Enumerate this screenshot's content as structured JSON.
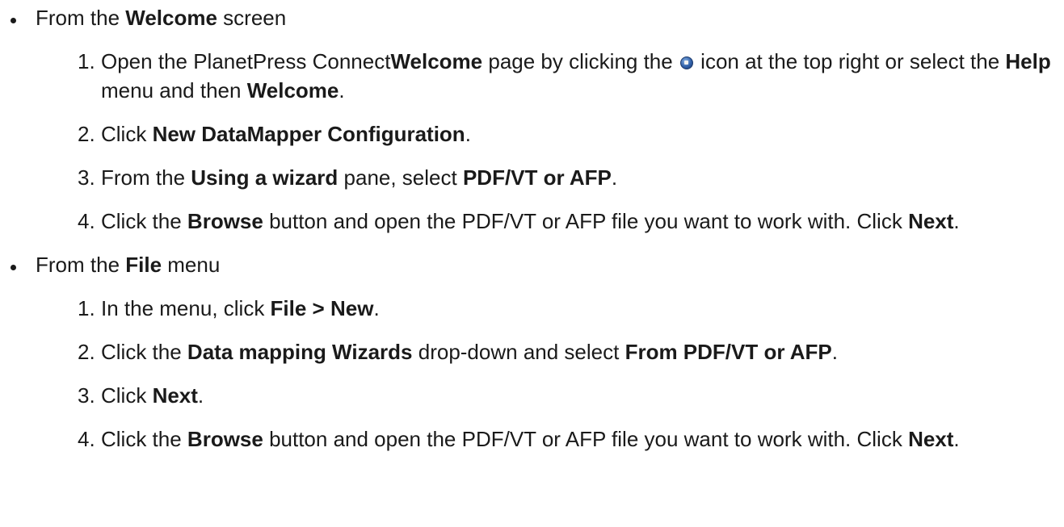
{
  "sections": [
    {
      "head_prefix": "From the ",
      "head_bold": "Welcome",
      "head_suffix": " screen",
      "steps": [
        {
          "num": "1.",
          "parts": [
            {
              "t": "Open the PlanetPress Connect",
              "b": false
            },
            {
              "t": "Welcome",
              "b": true
            },
            {
              "t": " page by clicking the ",
              "b": false
            },
            {
              "icon": "home-globe-icon"
            },
            {
              "t": " icon at the top right or select the ",
              "b": false
            },
            {
              "t": "Help",
              "b": true
            },
            {
              "t": " menu and then ",
              "b": false
            },
            {
              "t": "Welcome",
              "b": true
            },
            {
              "t": ".",
              "b": false
            }
          ]
        },
        {
          "num": "2.",
          "parts": [
            {
              "t": "Click ",
              "b": false
            },
            {
              "t": "New DataMapper Configuration",
              "b": true
            },
            {
              "t": ".",
              "b": false
            }
          ]
        },
        {
          "num": "3.",
          "parts": [
            {
              "t": "From the ",
              "b": false
            },
            {
              "t": "Using a wizard",
              "b": true
            },
            {
              "t": " pane, select ",
              "b": false
            },
            {
              "t": "PDF/VT or AFP",
              "b": true
            },
            {
              "t": ".",
              "b": false
            }
          ]
        },
        {
          "num": "4.",
          "parts": [
            {
              "t": "Click the ",
              "b": false
            },
            {
              "t": "Browse",
              "b": true
            },
            {
              "t": " button and open the PDF/VT or AFP file you want to work with. Click ",
              "b": false
            },
            {
              "t": "Next",
              "b": true
            },
            {
              "t": ".",
              "b": false
            }
          ]
        }
      ]
    },
    {
      "head_prefix": "From the ",
      "head_bold": "File",
      "head_suffix": " menu",
      "steps": [
        {
          "num": "1.",
          "parts": [
            {
              "t": "In the menu, click ",
              "b": false
            },
            {
              "t": "File > New",
              "b": true
            },
            {
              "t": ".",
              "b": false
            }
          ]
        },
        {
          "num": "2.",
          "parts": [
            {
              "t": "Click the ",
              "b": false
            },
            {
              "t": "Data mapping Wizards",
              "b": true
            },
            {
              "t": " drop-down and select ",
              "b": false
            },
            {
              "t": "From PDF/VT or AFP",
              "b": true
            },
            {
              "t": ".",
              "b": false
            }
          ]
        },
        {
          "num": "3.",
          "parts": [
            {
              "t": "Click ",
              "b": false
            },
            {
              "t": "Next",
              "b": true
            },
            {
              "t": ".",
              "b": false
            }
          ]
        },
        {
          "num": "4.",
          "parts": [
            {
              "t": "Click the ",
              "b": false
            },
            {
              "t": "Browse",
              "b": true
            },
            {
              "t": " button and open the PDF/VT or AFP file you want to work with. Click ",
              "b": false
            },
            {
              "t": "Next",
              "b": true
            },
            {
              "t": ".",
              "b": false
            }
          ]
        }
      ]
    }
  ]
}
